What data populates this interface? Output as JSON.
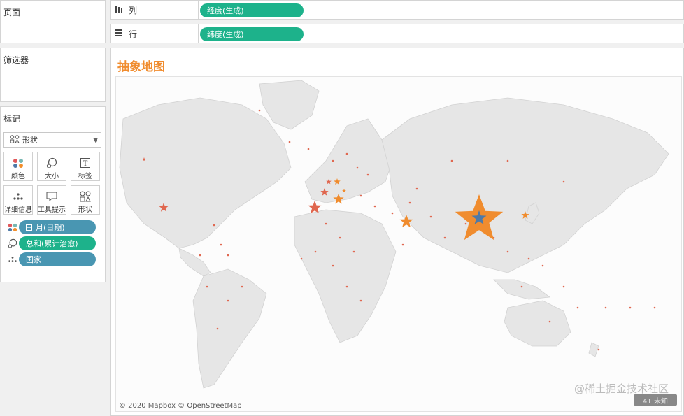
{
  "cards": {
    "pages_title": "页面",
    "filters_title": "筛选器",
    "marks_title": "标记"
  },
  "marks": {
    "type_label": "形状",
    "buttons": [
      {
        "id": "color",
        "label": "颜色",
        "icon": "color-dots-icon"
      },
      {
        "id": "size",
        "label": "大小",
        "icon": "size-icon"
      },
      {
        "id": "label",
        "label": "标签",
        "icon": "text-label-icon"
      },
      {
        "id": "detail",
        "label": "详细信息",
        "icon": "detail-dots-icon"
      },
      {
        "id": "tooltip",
        "label": "工具提示",
        "icon": "tooltip-icon"
      },
      {
        "id": "shape",
        "label": "形状",
        "icon": "shapes-icon"
      }
    ],
    "fields": [
      {
        "label": "月(日期)",
        "icon": "color-dots-icon",
        "style": "blue"
      },
      {
        "label": "总和(累计治愈)",
        "icon": "size-icon",
        "style": "green"
      },
      {
        "label": "国家",
        "icon": "detail-dots-icon",
        "style": "blue"
      }
    ]
  },
  "shelves": {
    "columns_label": "列",
    "rows_label": "行",
    "columns_pill": "经度(生成)",
    "rows_pill": "纬度(生成)"
  },
  "view": {
    "title": "抽象地图",
    "attribution": "© 2020 Mapbox © OpenStreetMap",
    "watermark": "@稀土掘金技术社区",
    "watermark_badge": "41 未知"
  },
  "colors": {
    "orange": "#f08c2e",
    "red_orange": "#e0674f",
    "blue_star": "#4e79a7",
    "pill_green": "#1db28b",
    "pill_blue": "#4996b2"
  }
}
